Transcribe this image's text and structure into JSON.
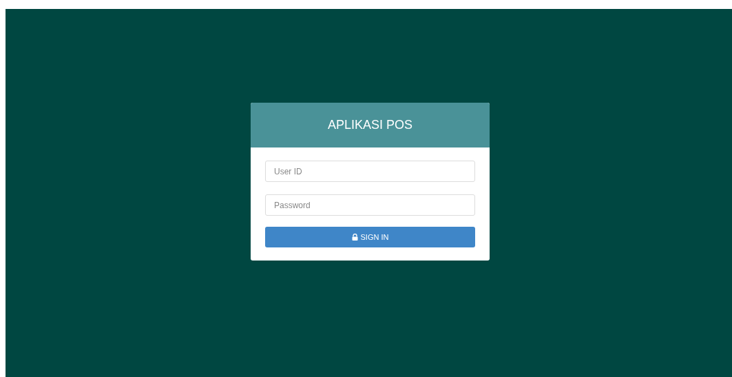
{
  "login_card": {
    "title": "APLIKASI POS",
    "fields": [
      {
        "placeholder": "User ID"
      },
      {
        "placeholder": "Password"
      }
    ],
    "submit_button": {
      "label": "SIGN IN"
    }
  }
}
